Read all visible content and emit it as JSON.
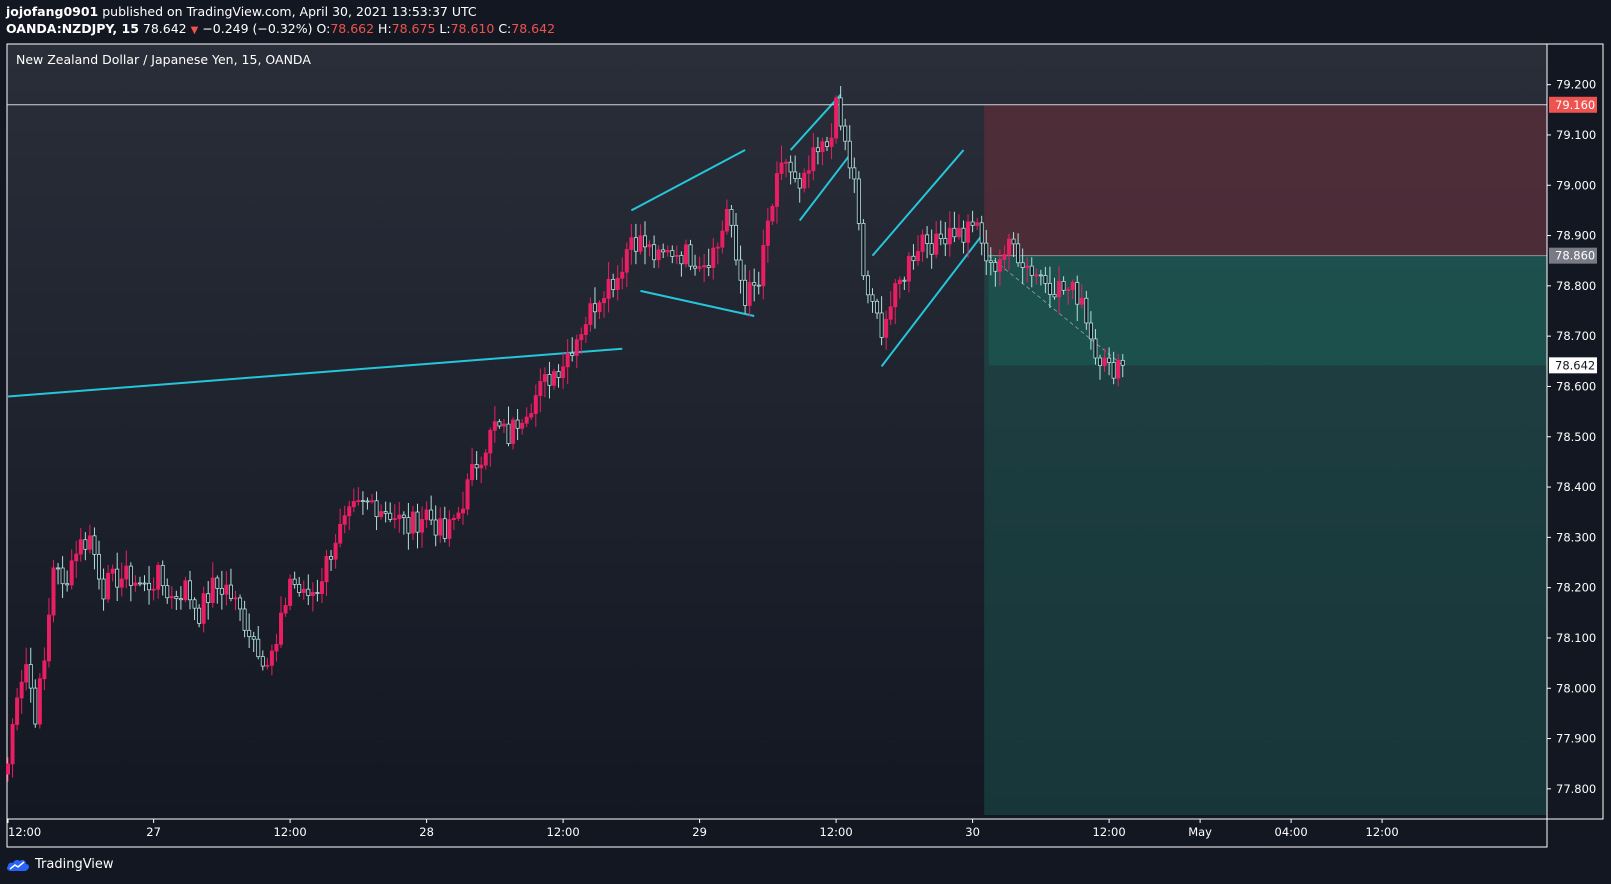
{
  "header": {
    "author": "jojofang0901",
    "published": "published on TradingView.com, April 30, 2021 13:53:37 UTC",
    "symbol": "OANDA:NZDJPY, 15",
    "last": "78.642",
    "change": "−0.249 (−0.32%)",
    "o_label": "O:",
    "o_val": "78.662",
    "h_label": "H:",
    "h_val": "78.675",
    "l_label": "L:",
    "l_val": "78.610",
    "c_label": "C:",
    "c_val": "78.642"
  },
  "footer": {
    "brand": "TradingView",
    "icon": "tradingview-cloud-icon"
  },
  "colors": {
    "background_top": "#2a2e39",
    "background_bottom": "#131722",
    "up": "#e91e63",
    "down": "#b2dfdb",
    "drawing": "#26c6da",
    "stop_zone": "#6d2f3a",
    "target_zone": "#1b5e57",
    "price_tag_stop": "#ef5350",
    "price_tag_entry": "#787b86"
  },
  "chart_data": {
    "type": "candlestick",
    "title": "New Zealand Dollar / Japanese Yen, 15, OANDA",
    "ylim": [
      77.75,
      79.25
    ],
    "y_ticks": [
      "77.800",
      "77.900",
      "78.000",
      "78.100",
      "78.200",
      "78.300",
      "78.400",
      "78.500",
      "78.600",
      "78.700",
      "78.800",
      "78.900",
      "79.000",
      "79.100",
      "79.200"
    ],
    "x_ticks": [
      {
        "label": "12:00",
        "i": 0
      },
      {
        "label": "27",
        "i": 32
      },
      {
        "label": "12:00",
        "i": 62
      },
      {
        "label": "28",
        "i": 92
      },
      {
        "label": "12:00",
        "i": 122
      },
      {
        "label": "29",
        "i": 152
      },
      {
        "label": "12:00",
        "i": 182
      },
      {
        "label": "30",
        "i": 212
      },
      {
        "label": "12:00",
        "i": 242
      },
      {
        "label": "May",
        "i": 262
      },
      {
        "label": "04:00",
        "i": 282
      },
      {
        "label": "12:00",
        "i": 302
      }
    ],
    "x_range": [
      0,
      330
    ],
    "anchors": [
      [
        0,
        77.85
      ],
      [
        2,
        78.0
      ],
      [
        4,
        78.05
      ],
      [
        6,
        77.95
      ],
      [
        8,
        78.05
      ],
      [
        10,
        78.25
      ],
      [
        12,
        78.2
      ],
      [
        15,
        78.28
      ],
      [
        18,
        78.3
      ],
      [
        21,
        78.2
      ],
      [
        24,
        78.22
      ],
      [
        27,
        78.22
      ],
      [
        30,
        78.2
      ],
      [
        33,
        78.22
      ],
      [
        36,
        78.18
      ],
      [
        39,
        78.2
      ],
      [
        42,
        78.15
      ],
      [
        45,
        78.2
      ],
      [
        48,
        78.2
      ],
      [
        51,
        78.15
      ],
      [
        54,
        78.1
      ],
      [
        57,
        78.05
      ],
      [
        59,
        78.08
      ],
      [
        62,
        78.22
      ],
      [
        65,
        78.18
      ],
      [
        68,
        78.2
      ],
      [
        72,
        78.3
      ],
      [
        76,
        78.35
      ],
      [
        80,
        78.37
      ],
      [
        84,
        78.35
      ],
      [
        88,
        78.32
      ],
      [
        92,
        78.35
      ],
      [
        96,
        78.3
      ],
      [
        99,
        78.35
      ],
      [
        103,
        78.45
      ],
      [
        107,
        78.52
      ],
      [
        110,
        78.5
      ],
      [
        113,
        78.55
      ],
      [
        116,
        78.58
      ],
      [
        119,
        78.62
      ],
      [
        122,
        78.65
      ],
      [
        125,
        78.7
      ],
      [
        128,
        78.75
      ],
      [
        131,
        78.8
      ],
      [
        134,
        78.82
      ],
      [
        137,
        78.9
      ],
      [
        140,
        78.88
      ],
      [
        143,
        78.85
      ],
      [
        146,
        78.87
      ],
      [
        150,
        78.86
      ],
      [
        153,
        78.85
      ],
      [
        156,
        78.88
      ],
      [
        158,
        78.95
      ],
      [
        160,
        78.85
      ],
      [
        162,
        78.78
      ],
      [
        165,
        78.8
      ],
      [
        167,
        78.92
      ],
      [
        169,
        79.0
      ],
      [
        171,
        79.05
      ],
      [
        174,
        78.98
      ],
      [
        177,
        79.05
      ],
      [
        180,
        79.08
      ],
      [
        182,
        79.15
      ],
      [
        184,
        79.08
      ],
      [
        186,
        79.0
      ],
      [
        188,
        78.82
      ],
      [
        190,
        78.75
      ],
      [
        192,
        78.72
      ],
      [
        195,
        78.78
      ],
      [
        198,
        78.85
      ],
      [
        201,
        78.9
      ],
      [
        204,
        78.88
      ],
      [
        207,
        78.92
      ],
      [
        210,
        78.9
      ],
      [
        212,
        78.93
      ],
      [
        214,
        78.88
      ],
      [
        216,
        78.83
      ],
      [
        218,
        78.86
      ],
      [
        221,
        78.88
      ],
      [
        224,
        78.84
      ],
      [
        227,
        78.82
      ],
      [
        230,
        78.8
      ],
      [
        233,
        78.79
      ],
      [
        236,
        78.78
      ],
      [
        238,
        78.7
      ],
      [
        240,
        78.66
      ],
      [
        242,
        78.63
      ],
      [
        244,
        78.65
      ],
      [
        245,
        78.642
      ]
    ],
    "drawings": [
      {
        "type": "trendline",
        "points": [
          [
            0,
            78.58
          ],
          [
            135,
            78.675
          ]
        ]
      },
      {
        "type": "trendline",
        "points": [
          [
            137,
            78.95
          ],
          [
            162,
            79.07
          ]
        ]
      },
      {
        "type": "trendline",
        "points": [
          [
            139,
            78.79
          ],
          [
            164,
            78.74
          ]
        ]
      },
      {
        "type": "trendline",
        "points": [
          [
            172,
            79.07
          ],
          [
            183,
            79.18
          ]
        ]
      },
      {
        "type": "trendline",
        "points": [
          [
            174,
            78.93
          ],
          [
            185,
            79.06
          ]
        ]
      },
      {
        "type": "trendline",
        "points": [
          [
            190,
            78.86
          ],
          [
            210,
            79.07
          ]
        ]
      },
      {
        "type": "trendline",
        "points": [
          [
            192,
            78.64
          ],
          [
            214,
            78.9
          ]
        ]
      },
      {
        "type": "horizontal_line",
        "price": 79.16
      }
    ],
    "position": {
      "type": "short",
      "start_i": 213,
      "end_i": 330,
      "entry": 78.86,
      "stop": 79.16,
      "target": 77.75,
      "entry_label": "78.860",
      "stop_label": "79.160",
      "current": 78.642,
      "current_label": "78.642",
      "current_start_i": 214
    }
  }
}
